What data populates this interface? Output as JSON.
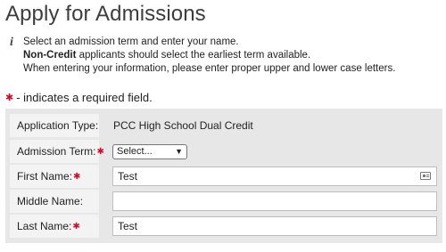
{
  "page": {
    "title": "Apply for Admissions"
  },
  "info": {
    "icon": "info-icon",
    "line1": "Select an admission term and enter your name.",
    "line2_bold": "Non-Credit",
    "line2_rest": " applicants should select the earliest term available.",
    "line3": "When entering your information, please enter proper upper and lower case letters."
  },
  "required_note": {
    "star": "✱",
    "text": "- indicates a required field."
  },
  "form": {
    "application_type": {
      "label": "Application Type:",
      "value": "PCC High School Dual Credit"
    },
    "admission_term": {
      "label": "Admission Term:",
      "selected": "Select..."
    },
    "first_name": {
      "label": "First Name:",
      "value": "Test"
    },
    "middle_name": {
      "label": "Middle Name:",
      "value": ""
    },
    "last_name": {
      "label": "Last Name:",
      "value": "Test"
    }
  },
  "colors": {
    "required_star": "#c8102e",
    "panel_bg": "#e7e7e7",
    "label_bg": "#f3f3f3"
  }
}
